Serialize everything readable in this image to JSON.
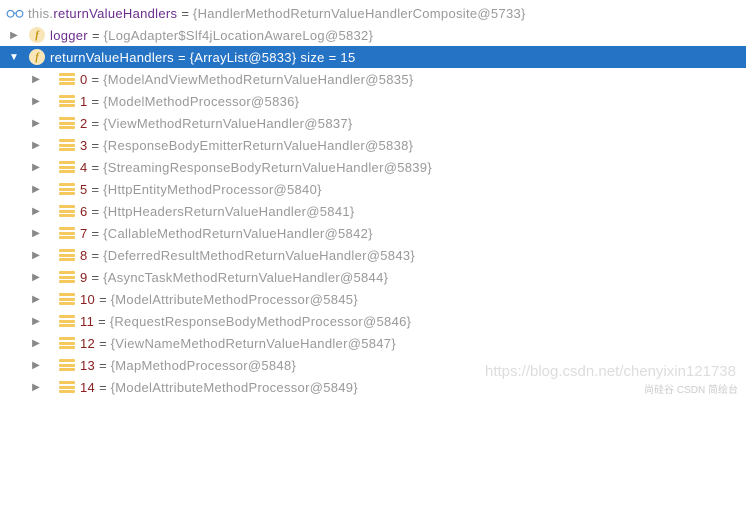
{
  "root": {
    "prefix": "this.",
    "name": "returnValueHandlers",
    "value": "{HandlerMethodReturnValueHandlerComposite@5733}"
  },
  "logger": {
    "name": "logger",
    "value": "{LogAdapter$Slf4jLocationAwareLog@5832}"
  },
  "list": {
    "name": "returnValueHandlers",
    "value": "{ArrayList@5833}  size = 15"
  },
  "items": [
    {
      "index": "0",
      "value": "{ModelAndViewMethodReturnValueHandler@5835}"
    },
    {
      "index": "1",
      "value": "{ModelMethodProcessor@5836}"
    },
    {
      "index": "2",
      "value": "{ViewMethodReturnValueHandler@5837}"
    },
    {
      "index": "3",
      "value": "{ResponseBodyEmitterReturnValueHandler@5838}"
    },
    {
      "index": "4",
      "value": "{StreamingResponseBodyReturnValueHandler@5839}"
    },
    {
      "index": "5",
      "value": "{HttpEntityMethodProcessor@5840}"
    },
    {
      "index": "6",
      "value": "{HttpHeadersReturnValueHandler@5841}"
    },
    {
      "index": "7",
      "value": "{CallableMethodReturnValueHandler@5842}"
    },
    {
      "index": "8",
      "value": "{DeferredResultMethodReturnValueHandler@5843}"
    },
    {
      "index": "9",
      "value": "{AsyncTaskMethodReturnValueHandler@5844}"
    },
    {
      "index": "10",
      "value": "{ModelAttributeMethodProcessor@5845}"
    },
    {
      "index": "11",
      "value": "{RequestResponseBodyMethodProcessor@5846}"
    },
    {
      "index": "12",
      "value": "{ViewNameMethodReturnValueHandler@5847}"
    },
    {
      "index": "13",
      "value": "{MapMethodProcessor@5848}"
    },
    {
      "index": "14",
      "value": "{ModelAttributeMethodProcessor@5849}"
    }
  ],
  "watermark": "https://blog.csdn.net/chenyixin121738",
  "watermark2": "尚硅谷 CSDN 简绘台"
}
